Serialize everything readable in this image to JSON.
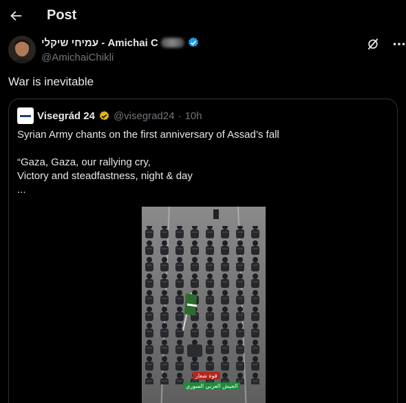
{
  "header": {
    "title": "Post"
  },
  "author": {
    "display_name": "עמיחי שיקלי - Amichai C",
    "handle": "@AmichaiChikli"
  },
  "post": {
    "text": "War is inevitable"
  },
  "quote": {
    "name": "Visegrád 24",
    "handle": "@visegrad24",
    "separator": "·",
    "time": "10h",
    "lines": [
      "Syrian Army chants on the first anniversary of Assad’s fall",
      "“Gaza, Gaza, our rallying cry,",
      "Victory and steadfastness, night & day",
      "..."
    ],
    "video_caption_lines": [
      "قوة شعار",
      "الجيش العربي السوري"
    ]
  },
  "colors": {
    "background": "#000000",
    "text": "#e7e9ea",
    "secondary": "#71767b",
    "verified_blue": "#1d9bf0",
    "verified_gold": "#e2b719",
    "border": "#2f3336"
  }
}
